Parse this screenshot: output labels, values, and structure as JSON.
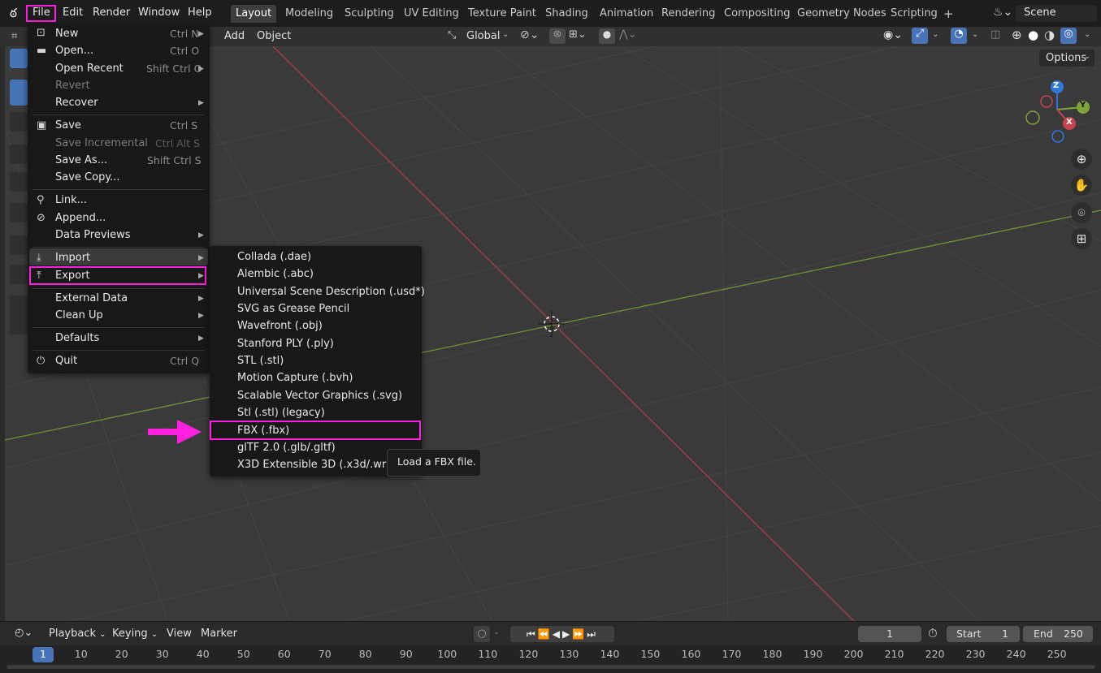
{
  "topbar": {
    "menus": [
      "File",
      "Edit",
      "Render",
      "Window",
      "Help"
    ],
    "workspaces": [
      "Layout",
      "Modeling",
      "Sculpting",
      "UV Editing",
      "Texture Paint",
      "Shading",
      "Animation",
      "Rendering",
      "Compositing",
      "Geometry Nodes",
      "Scripting"
    ],
    "add_tab": "+",
    "scene": "Scene"
  },
  "header": {
    "add": "Add",
    "object": "Object",
    "transform_orientation": "Global",
    "options": "Options"
  },
  "file_menu": {
    "items": [
      {
        "label": "New",
        "shortcut": "Ctrl N",
        "submenu": true,
        "disabled": false
      },
      {
        "label": "Open...",
        "shortcut": "Ctrl O",
        "submenu": false,
        "disabled": false
      },
      {
        "label": "Open Recent",
        "shortcut": "Shift Ctrl O",
        "submenu": true,
        "disabled": false
      },
      {
        "label": "Revert",
        "shortcut": "",
        "submenu": false,
        "disabled": true
      },
      {
        "label": "Recover",
        "shortcut": "",
        "submenu": true,
        "disabled": false
      },
      {
        "label": "Save",
        "shortcut": "Ctrl S",
        "submenu": false,
        "disabled": false
      },
      {
        "label": "Save Incremental",
        "shortcut": "Ctrl Alt S",
        "submenu": false,
        "disabled": true
      },
      {
        "label": "Save As...",
        "shortcut": "Shift Ctrl S",
        "submenu": false,
        "disabled": false
      },
      {
        "label": "Save Copy...",
        "shortcut": "",
        "submenu": false,
        "disabled": false
      },
      {
        "label": "Link...",
        "shortcut": "",
        "submenu": false,
        "disabled": false
      },
      {
        "label": "Append...",
        "shortcut": "",
        "submenu": false,
        "disabled": false
      },
      {
        "label": "Data Previews",
        "shortcut": "",
        "submenu": true,
        "disabled": false
      },
      {
        "label": "Import",
        "shortcut": "",
        "submenu": true,
        "disabled": false
      },
      {
        "label": "Export",
        "shortcut": "",
        "submenu": true,
        "disabled": false
      },
      {
        "label": "External Data",
        "shortcut": "",
        "submenu": true,
        "disabled": false
      },
      {
        "label": "Clean Up",
        "shortcut": "",
        "submenu": true,
        "disabled": false
      },
      {
        "label": "Defaults",
        "shortcut": "",
        "submenu": true,
        "disabled": false
      },
      {
        "label": "Quit",
        "shortcut": "Ctrl Q",
        "submenu": false,
        "disabled": false
      }
    ]
  },
  "export_menu": {
    "items": [
      "Collada (.dae)",
      "Alembic (.abc)",
      "Universal Scene Description (.usd*)",
      "SVG as Grease Pencil",
      "Wavefront (.obj)",
      "Stanford PLY (.ply)",
      "STL (.stl)",
      "Motion Capture (.bvh)",
      "Scalable Vector Graphics (.svg)",
      "Stl (.stl) (legacy)",
      "FBX (.fbx)",
      "glTF 2.0 (.glb/.gltf)",
      "X3D Extensible 3D (.x3d/.wrl)"
    ],
    "highlighted": "FBX (.fbx)"
  },
  "tooltip": "Load a FBX file.",
  "gizmo": {
    "z": "Z",
    "y": "Y",
    "x": "X"
  },
  "timeline": {
    "playback": "Playback",
    "keying": "Keying",
    "view": "View",
    "marker": "Marker",
    "current_frame": "1",
    "start_label": "Start",
    "start": "1",
    "end_label": "End",
    "end": "250",
    "ticks": [
      "1",
      "10",
      "20",
      "30",
      "40",
      "50",
      "60",
      "70",
      "80",
      "90",
      "100",
      "110",
      "120",
      "130",
      "140",
      "150",
      "160",
      "170",
      "180",
      "190",
      "200",
      "210",
      "220",
      "230",
      "240",
      "250"
    ]
  },
  "colors": {
    "highlight": "#ff1fde",
    "x_axis": "#c8424d",
    "y_axis": "#7ea43a",
    "z_axis": "#2f78d8"
  }
}
